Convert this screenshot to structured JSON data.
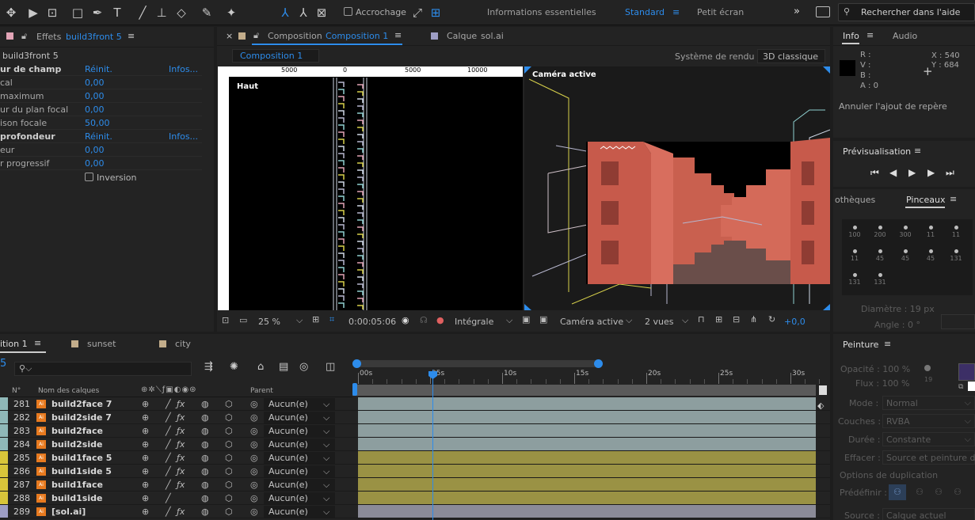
{
  "toolbar": {
    "snap_label": "Accrochage",
    "workspaces": [
      "Informations essentielles",
      "Standard",
      "Petit écran"
    ],
    "search_placeholder": "Rechercher dans l'aide"
  },
  "effects_panel": {
    "tab_label": "Effets",
    "tab_layer": "build3front 5",
    "layer_path": "build3front 5",
    "rows": [
      {
        "label": "ur de champ",
        "value": "Réinit.",
        "extra": "Infos...",
        "bold": true
      },
      {
        "label": "cal",
        "value": "0,00"
      },
      {
        "label": "maximum",
        "value": "0,00"
      },
      {
        "label": "ur du plan focal",
        "value": "0,00"
      },
      {
        "label": "ison focale",
        "value": "50,00"
      },
      {
        "label": "profondeur",
        "value": "Réinit.",
        "extra": "Infos...",
        "bold": true
      },
      {
        "label": "eur",
        "value": "0,00"
      },
      {
        "label": "r progressif",
        "value": "0,00"
      }
    ],
    "inversion_label": "Inversion"
  },
  "composition_panel": {
    "tab_label": "Composition",
    "tab_comp": "Composition 1",
    "layer_tab_label": "Calque",
    "layer_tab_name": "sol.ai",
    "sub_tab": "Composition 1",
    "renderer_label": "Système de rendu :",
    "renderer_value": "3D classique",
    "left_view_label": "Haut",
    "right_view_label": "Caméra active",
    "ruler_marks": [
      "5000",
      "0",
      "5000",
      "10000"
    ],
    "footer": {
      "zoom": "25 %",
      "timecode": "0:00:05:06",
      "resolution": "Intégrale",
      "camera": "Caméra active",
      "views": "2 vues",
      "exposure": "+0,0"
    }
  },
  "info_panel": {
    "tabs": [
      "Info",
      "Audio"
    ],
    "channels": [
      "R :",
      "V :",
      "B :",
      "A : 0"
    ],
    "x": "X : 540",
    "y": "Y : 684",
    "message": "Annuler l'ajout de repère"
  },
  "preview_panel": {
    "title": "Prévisualisation"
  },
  "brushes_panel": {
    "tab_left": "othèques",
    "tab_active": "Pinceaux",
    "sizes": [
      "100",
      "200",
      "300",
      "11",
      "11",
      "11",
      "45",
      "45",
      "45",
      "131",
      "131",
      "131"
    ],
    "diameter": "Diamètre : 19  px",
    "angle": "Angle : 0 °"
  },
  "timeline": {
    "tabs": [
      "ition 1",
      "sunset",
      "city"
    ],
    "time_value": "5",
    "col_no": "N°",
    "col_name": "Nom des calques",
    "col_parent": "Parent",
    "ruler_labels": [
      "00s",
      "05s",
      "10s",
      "15s",
      "20s",
      "25s",
      "30s"
    ],
    "layers": [
      {
        "no": "281",
        "name": "build2face 7",
        "parent": "Aucun(e)",
        "color": "#8fb8b8",
        "track": "#8d9e9f",
        "fx": true
      },
      {
        "no": "282",
        "name": "build2side 7",
        "parent": "Aucun(e)",
        "color": "#8fb8b8",
        "track": "#8d9e9f",
        "fx": true
      },
      {
        "no": "283",
        "name": "build2face",
        "parent": "Aucun(e)",
        "color": "#8fb8b8",
        "track": "#8d9e9f",
        "fx": true
      },
      {
        "no": "284",
        "name": "build2side",
        "parent": "Aucun(e)",
        "color": "#8fb8b8",
        "track": "#8d9e9f",
        "fx": true
      },
      {
        "no": "285",
        "name": "build1face 5",
        "parent": "Aucun(e)",
        "color": "#d8c53a",
        "track": "#9a9244",
        "fx": true
      },
      {
        "no": "286",
        "name": "build1side 5",
        "parent": "Aucun(e)",
        "color": "#d8c53a",
        "track": "#9a9244",
        "fx": true
      },
      {
        "no": "287",
        "name": "build1face",
        "parent": "Aucun(e)",
        "color": "#d8c53a",
        "track": "#9a9244",
        "fx": true
      },
      {
        "no": "288",
        "name": "build1side",
        "parent": "Aucun(e)",
        "color": "#d8c53a",
        "track": "#9a9244",
        "fx": false
      },
      {
        "no": "289",
        "name": "[sol.ai]",
        "parent": "Aucun(e)",
        "color": "#9d9dc4",
        "track": "#8b8b98",
        "fx": true
      }
    ]
  },
  "paint_panel": {
    "title": "Peinture",
    "opacity": "Opacité : 100 %",
    "flow": "Flux : 100 %",
    "brush_size": "19",
    "mode_label": "Mode :",
    "mode_value": "Normal",
    "channels_label": "Couches :",
    "channels_value": "RVBA",
    "duration_label": "Durée :",
    "duration_value": "Constante",
    "erase_label": "Effacer :",
    "erase_value": "Source et peinture d...",
    "clone_options": "Options de duplication",
    "preset_label": "Prédéfinir :",
    "source_label": "Source :",
    "source_value": "Calque actuel"
  },
  "colors": {
    "accent": "#2d8ceb",
    "panel": "#232323",
    "background": "#1d1d1d"
  }
}
